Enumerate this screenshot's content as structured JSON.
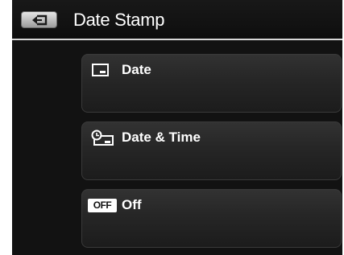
{
  "header": {
    "title": "Date Stamp",
    "back_icon": "back-arrow-icon"
  },
  "menu": {
    "items": [
      {
        "label": "Date",
        "icon": "date-icon"
      },
      {
        "label": "Date & Time",
        "icon": "date-time-icon"
      },
      {
        "label": "Off",
        "icon": "off-icon",
        "badge": "OFF"
      }
    ]
  },
  "colors": {
    "background": "#121212",
    "header_divider": "#d8d8d8",
    "text": "#ffffff"
  }
}
